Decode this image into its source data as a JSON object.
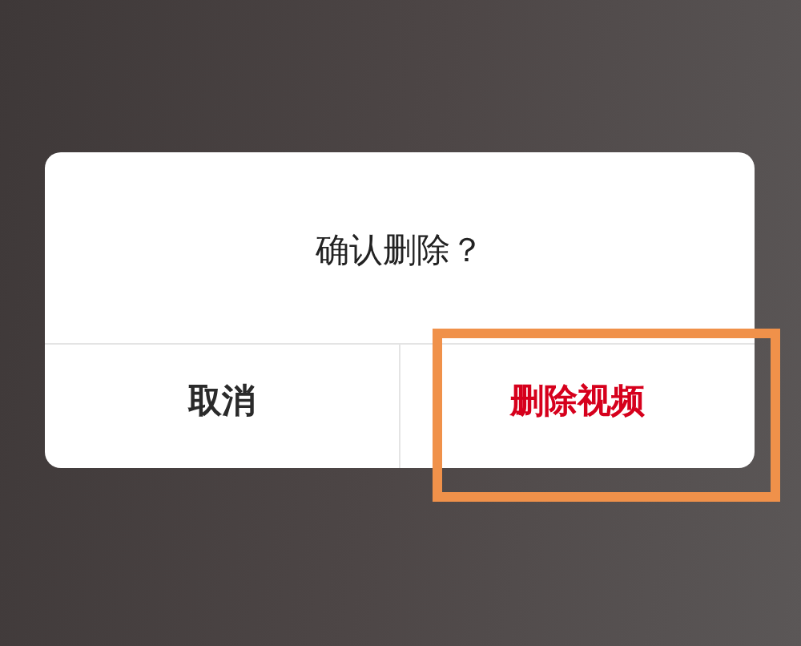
{
  "dialog": {
    "title": "确认删除？",
    "buttons": [
      {
        "label": "取消",
        "kind": "cancel",
        "highlighted": false
      },
      {
        "label": "删除视频",
        "kind": "destructive",
        "highlighted": true
      }
    ]
  }
}
